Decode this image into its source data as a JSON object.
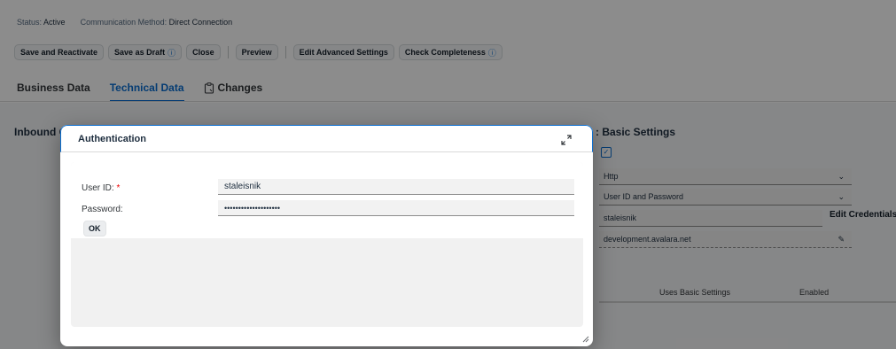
{
  "header": {
    "status_label": "Status:",
    "status_value": "Active",
    "comm_label": "Communication Method:",
    "comm_value": "Direct Connection"
  },
  "toolbar": {
    "save_reactivate": "Save and Reactivate",
    "save_draft": "Save as Draft",
    "close": "Close",
    "preview": "Preview",
    "edit_advanced": "Edit Advanced Settings",
    "check_completeness": "Check Completeness",
    "help_glyph": "ⓘ"
  },
  "tabs": [
    {
      "label": "Business Data",
      "active": false
    },
    {
      "label": "Technical Data",
      "active": true
    },
    {
      "label": "Changes",
      "active": false,
      "icon": "clipboard-icon"
    }
  ],
  "background": {
    "left_section_title": "Inbound C",
    "right_section_title": ": Basic Settings",
    "protocol_value": "Http",
    "auth_method_value": "User ID and Password",
    "user_value": "staleisnik",
    "edit_credentials": "Edit Credentials",
    "host_value": "development.avalara.net",
    "table_col_uses": "Uses Basic Settings",
    "table_col_enabled": "Enabled"
  },
  "dialog": {
    "title": "Authentication",
    "user_id_label": "User ID:",
    "required_marker": "*",
    "user_id_value": "staleisnik",
    "password_label": "Password:",
    "password_value": "••••••••••••••••••••",
    "ok_label": "OK"
  },
  "colors": {
    "accent": "#0a6ed1",
    "required": "#ee0000"
  }
}
